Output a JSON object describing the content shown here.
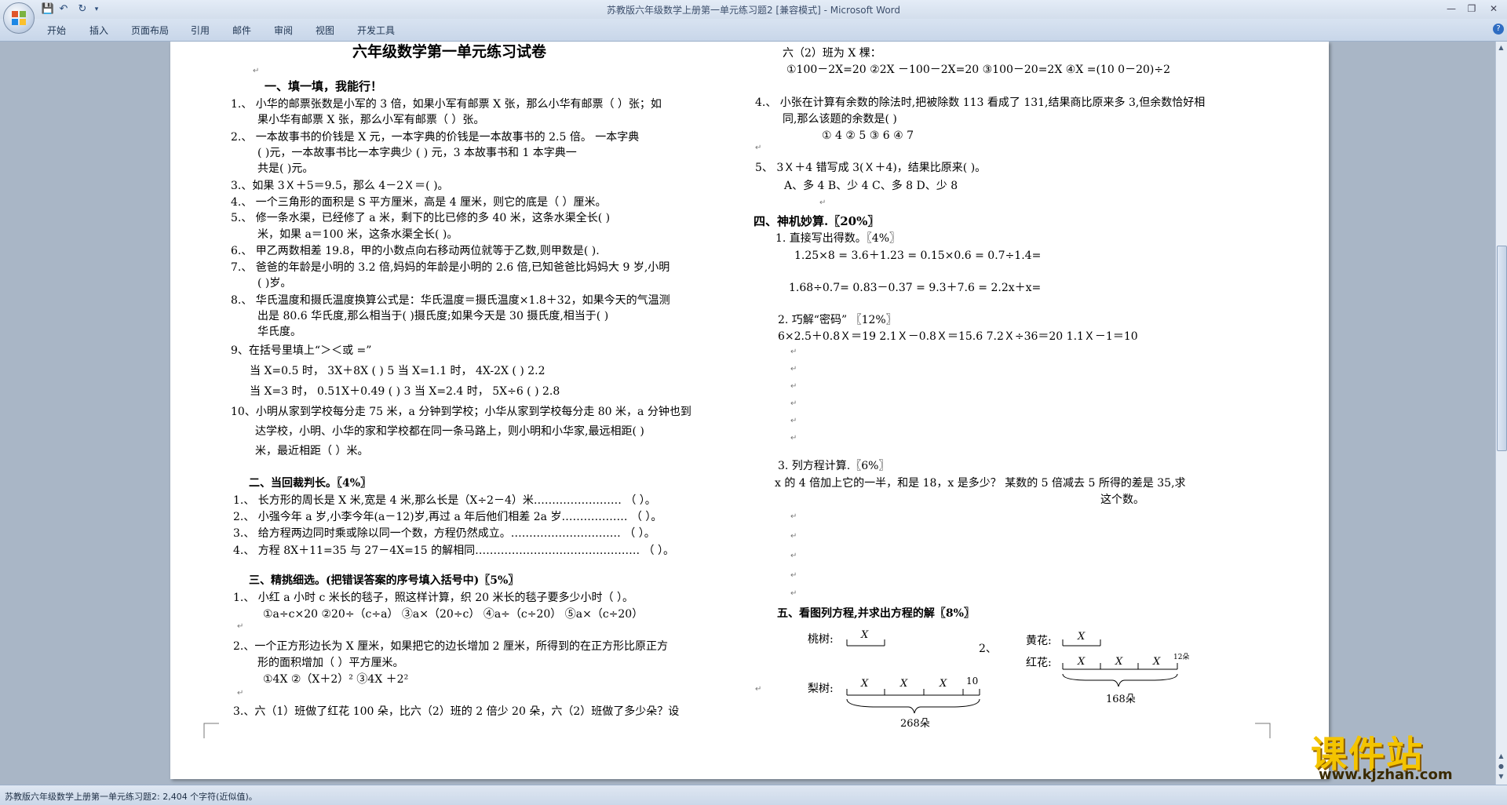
{
  "window": {
    "title": "苏教版六年级数学上册第一单元练习题2 [兼容模式] - Microsoft Word"
  },
  "ribbon": {
    "tabs": [
      "开始",
      "插入",
      "页面布局",
      "引用",
      "邮件",
      "审阅",
      "视图",
      "开发工具"
    ]
  },
  "quick_access": {
    "save_icon": "save-icon",
    "undo_icon": "undo-icon",
    "redo_icon": "redo-icon",
    "customize_icon": "customize-icon"
  },
  "status": {
    "text": "苏教版六年级数学上册第一单元练习题2: 2,404 个字符(近似值)。"
  },
  "watermark": {
    "text": "课件站",
    "url": "www.kjzhan.com"
  },
  "doc": {
    "title": "六年级数学第一单元练习试卷",
    "s1": "一、填一填，我能行！",
    "l1a": "1.、 小华的邮票张数是小军的 3 倍，如果小军有邮票 X 张，那么小华有邮票（       ）张；如",
    "l1b": "果小华有邮票 X 张，那么小军有邮票（       ）张。",
    "l2a": "2.、 一本故事书的价钱是 X 元，一本字典的价钱是一本故事书的  2.5 倍。  一本字典",
    "l2b": "(            )元，一本故事书比一本字典少 (              ) 元，3 本故事书和 1 本字典一",
    "l2c": "共是(          )元。",
    "l3": "3.、如果 3Ｘ＋5＝9.5，那么 4－2Ｘ＝(          )。",
    "l4": "4.、 一个三角形的面积是 S 平方厘米，高是 4 厘米，则它的底是（       ）厘米。",
    "l5a": "5.、 修一条水渠，已经修了  a 米，剩下的比已修的多  40 米，这条水渠全长(               )",
    "l5b": "米，如果 a＝100 米，这条水渠全长(             )。",
    "l6": "6.、 甲乙两数相差 19.8，甲的小数点向右移动两位就等于乙数,则甲数是(          ).",
    "l7a": "7.、 爸爸的年龄是小明的  3.2 倍,妈妈的年龄是小明的  2.6 倍,已知爸爸比妈妈大  9 岁,小明",
    "l7b": "(       )岁。",
    "l8a": "8.、 华氏温度和摄氏温度换算公式是：华氏温度＝摄氏温度×1.8＋32，如果今天的气温测",
    "l8b": "出是 80.6 华氏度,那么相当于(          )摄氏度;如果今天是 30 摄氏度,相当于(        )",
    "l8c": "华氏度。",
    "l9": "9、在括号里填上“＞＜或 =”",
    "l9a": "当 X=0.5 时， 3X＋8X       (     ) 5           当 X=1.1 时， 4X-2X (     ) 2.2",
    "l9b": "当 X=3 时，  0.51X＋0.49 (     ) 3           当 X=2.4 时， 5X÷6 (     ) 2.8",
    "l10a": "10、小明从家到学校每分走 75 米，a 分钟到学校；小华从家到学校每分走 80 米，a 分钟也到",
    "l10b": "达学校，小明、小华的家和学校都在同一条马路上，则小明和小华家,最远相距(            )",
    "l10c": "米，最近相距（           ）米。",
    "s2": "二、当回裁判长。〖4%〗",
    "j1": "1.、  长方形的周长是 X 米,宽是 4 米,那么长是（X÷2－4）米……………………    （      ）。",
    "j2": "2.、  小强今年 a 岁,小李今年(a－12)岁,再过 a 年后他们相差 2a 岁………………    （      ）。",
    "j3": "3.、  给方程两边同时乘或除以同一个数，方程仍然成立。…………………………    （      ）。",
    "j4": "4.、  方程 8X＋11=35 与 27－4X=15 的解相同………………………………………    （      ）。",
    "s3": "三、精挑细选。(把错误答案的序号填入括号中)〖5%〗",
    "c1": "1.、  小红 a 小时 c 米长的毯子，照这样计算，织 20 米长的毯子要多少小时（       ）。",
    "c1o": "①a÷c×20    ②20÷（c÷a） ③a×（20÷c） ④a÷（c÷20） ⑤a×（c÷20）",
    "c2a": "2.、一个正方形边长为 X 厘米，如果把它的边长增加 2 厘米，所得到的在正方形比原正方",
    "c2b": "形的面积增加（        ）平方厘米。",
    "c2o": "①4X                ②（X＋2）²        ③4X ＋2²",
    "c3a": "3.、六（1）班做了红花 100 朵，比六（2）班的 2 倍少 20 朵，六（2）班做了多少朵？设",
    "r1": "六（2）班为 X 棵：",
    "r1o": "①100－2X=20     ②2X －100－2X=20     ③100－20=2X       ④X =(10 0－20)÷2",
    "r4a": "4.、 小张在计算有余数的除法时,把被除数 113 看成了 131,结果商比原来多 3,但余数恰好相",
    "r4b": "同,那么该题的余数是(          )",
    "r4o": "①  4          ②  5          ③   6          ④   7",
    "r5": "5、  3Ｘ＋4 错写成 3(Ｘ＋4)，结果比原来(          )。",
    "r5o": "A、多 4      B、少 4    C、多 8      D、少 8",
    "s4": "四、神机妙算.〖20%〗",
    "m1": "1. 直接写出得数。〖4%〗",
    "m1a": "1.25×8 =          3.6＋1.23  =        0.15×0.6 =          0.7÷1.4=",
    "m1b": "1.68÷0.7=          0.83－0.37 =             9.3＋7.6 =          2.2x＋x=",
    "m2": "2. 巧解“密码” 〖12%〗",
    "m2a": "6×2.5＋0.8Ｘ＝19        2.1Ｘ－0.8Ｘ＝15.6          7.2Ｘ÷36＝20      1.1Ｘ－1＝10",
    "m3": "3. 列方程计算.〖6%〗",
    "m3a": "x 的 4 倍加上它的一半，和是 18，x 是多少？          某数的 5 倍减去 5 所得的差是 35,求",
    "m3b": "这个数。",
    "s5": "五、看图列方程,并求出方程的解〖8%〗",
    "fig1": {
      "peach": "桃树:",
      "x": "X",
      "pear": "梨树:",
      "ten": "10",
      "total": "268朵"
    },
    "fig2": {
      "num": "2、",
      "yellow": "黄花:",
      "red": "红花:",
      "x": "X",
      "twelve": "12朵",
      "total": "168朵"
    }
  }
}
